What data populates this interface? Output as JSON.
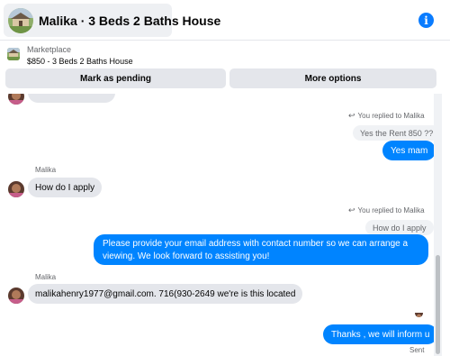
{
  "header": {
    "title": "Malika · 3 Beds 2 Baths House",
    "info_icon": "info-icon"
  },
  "listing": {
    "source": "Marketplace",
    "summary": "$850 - 3 Beds 2 Baths House",
    "mark_pending_label": "Mark as pending",
    "more_options_label": "More options"
  },
  "messages": {
    "reply_note_1": "You replied to Malika",
    "quote_1": "Yes the Rent 850 ??",
    "out_1": "Yes mam",
    "sender_1": "Malika",
    "in_1": "How do I apply",
    "reply_note_2": "You replied to Malika",
    "quote_2": "How do I apply",
    "out_2": "Please provide your  email address with contact number so we can  arrange a viewing. We look forward to assisting you!",
    "sender_2": "Malika",
    "in_2": "malikahenry1977@gmail.com. 716(930-2649   we're is this located",
    "out_3": "Thanks , we will inform u",
    "status": "Sent"
  },
  "colors": {
    "outgoing_bubble": "#0084ff",
    "incoming_bubble": "#e4e6eb",
    "accent": "#0a7cff"
  }
}
